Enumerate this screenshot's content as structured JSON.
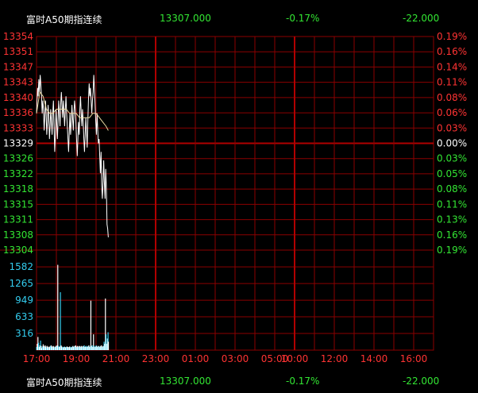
{
  "header": {
    "title": "富时A50期指连续",
    "price": "13307.000",
    "pct_change": "-0.17%",
    "change": "-22.000"
  },
  "footer": {
    "title": "富时A50期指连续",
    "price": "13307.000",
    "pct_change": "-0.17%",
    "change": "-22.000"
  },
  "colors": {
    "grid": "#8b0000",
    "grid_mid": "#b00000",
    "price_line": "#ffffff",
    "avg_line": "#e8d8a0",
    "up": "#ff3333",
    "down": "#33e633",
    "flat": "#ffffff",
    "volume_axis": "#33ccee",
    "volume_bar": "#ffffff",
    "volume_bar_alt": "#33ccee"
  },
  "chart_data": {
    "type": "line",
    "price_axis": {
      "ticks": [
        "13354",
        "13351",
        "13347",
        "13343",
        "13340",
        "13336",
        "13333",
        "13329",
        "13326",
        "13322",
        "13318",
        "13315",
        "13311",
        "13308",
        "13304"
      ],
      "base": 13329,
      "ylim": [
        13304,
        13354
      ]
    },
    "pct_axis": {
      "ticks": [
        "0.19%",
        "0.16%",
        "0.14%",
        "0.11%",
        "0.08%",
        "0.06%",
        "0.03%",
        "0.00%",
        "0.03%",
        "0.05%",
        "0.08%",
        "0.11%",
        "0.13%",
        "0.16%",
        "0.19%"
      ]
    },
    "volume_axis": {
      "ticks": [
        "1582",
        "1265",
        "949",
        "633",
        "316"
      ],
      "ylim": [
        0,
        1900
      ]
    },
    "x_ticks": [
      "17:00",
      "19:00",
      "21:00",
      "23:00",
      "01:00",
      "03:00",
      "05:00",
      "10:00",
      "12:00",
      "14:00",
      "16:00"
    ],
    "x_tick_minutes": [
      0,
      120,
      240,
      360,
      480,
      600,
      720,
      780,
      900,
      1020,
      1140
    ],
    "x_range_minutes": [
      0,
      1200
    ],
    "series": [
      {
        "values": [
          [
            0,
            13336
          ],
          [
            3,
            13342
          ],
          [
            5,
            13340
          ],
          [
            7,
            13344
          ],
          [
            9,
            13341
          ],
          [
            11,
            13345
          ],
          [
            13,
            13343
          ],
          [
            15,
            13340
          ],
          [
            17,
            13336
          ],
          [
            19,
            13339
          ],
          [
            21,
            13337
          ],
          [
            23,
            13332
          ],
          [
            25,
            13335
          ],
          [
            27,
            13339
          ],
          [
            29,
            13336
          ],
          [
            31,
            13331
          ],
          [
            33,
            13334
          ],
          [
            35,
            13338
          ],
          [
            37,
            13335
          ],
          [
            39,
            13330
          ],
          [
            41,
            13333
          ],
          [
            43,
            13337
          ],
          [
            45,
            13334
          ],
          [
            47,
            13331
          ],
          [
            49,
            13336
          ],
          [
            51,
            13339
          ],
          [
            53,
            13333
          ],
          [
            55,
            13327
          ],
          [
            57,
            13331
          ],
          [
            59,
            13337
          ],
          [
            61,
            13334
          ],
          [
            63,
            13330
          ],
          [
            65,
            13334
          ],
          [
            67,
            13339
          ],
          [
            69,
            13336
          ],
          [
            71,
            13333
          ],
          [
            73,
            13338
          ],
          [
            75,
            13341
          ],
          [
            77,
            13338
          ],
          [
            79,
            13335
          ],
          [
            81,
            13339
          ],
          [
            83,
            13336
          ],
          [
            85,
            13333
          ],
          [
            87,
            13337
          ],
          [
            89,
            13340
          ],
          [
            91,
            13336
          ],
          [
            93,
            13333
          ],
          [
            95,
            13330
          ],
          [
            97,
            13327
          ],
          [
            99,
            13332
          ],
          [
            101,
            13336
          ],
          [
            103,
            13331
          ],
          [
            105,
            13334
          ],
          [
            107,
            13338
          ],
          [
            109,
            13335
          ],
          [
            111,
            13332
          ],
          [
            113,
            13336
          ],
          [
            115,
            13339
          ],
          [
            117,
            13337
          ],
          [
            119,
            13334
          ],
          [
            121,
            13330
          ],
          [
            123,
            13326
          ],
          [
            125,
            13330
          ],
          [
            127,
            13334
          ],
          [
            129,
            13331
          ],
          [
            131,
            13337
          ],
          [
            133,
            13340
          ],
          [
            135,
            13336
          ],
          [
            137,
            13333
          ],
          [
            139,
            13337
          ],
          [
            141,
            13334
          ],
          [
            143,
            13330
          ],
          [
            145,
            13327
          ],
          [
            147,
            13331
          ],
          [
            149,
            13335
          ],
          [
            151,
            13332
          ],
          [
            153,
            13328
          ],
          [
            155,
            13334
          ],
          [
            157,
            13339
          ],
          [
            159,
            13343
          ],
          [
            161,
            13340
          ],
          [
            163,
            13342
          ],
          [
            165,
            13339
          ],
          [
            167,
            13336
          ],
          [
            169,
            13339
          ],
          [
            171,
            13341
          ],
          [
            173,
            13345
          ],
          [
            175,
            13342
          ],
          [
            177,
            13338
          ],
          [
            179,
            13334
          ],
          [
            181,
            13331
          ],
          [
            183,
            13336
          ],
          [
            185,
            13332
          ],
          [
            187,
            13329
          ],
          [
            189,
            13330
          ],
          [
            191,
            13326
          ],
          [
            193,
            13322
          ],
          [
            195,
            13327
          ],
          [
            197,
            13319
          ],
          [
            199,
            13316
          ],
          [
            201,
            13320
          ],
          [
            203,
            13325
          ],
          [
            205,
            13320
          ],
          [
            207,
            13316
          ],
          [
            209,
            13323
          ],
          [
            211,
            13319
          ],
          [
            213,
            13310
          ],
          [
            215,
            13309
          ],
          [
            217,
            13307
          ]
        ]
      },
      {
        "values": [
          [
            0,
            13336
          ],
          [
            10,
            13341
          ],
          [
            20,
            13340
          ],
          [
            30,
            13337
          ],
          [
            40,
            13336
          ],
          [
            50,
            13336
          ],
          [
            60,
            13337
          ],
          [
            70,
            13337
          ],
          [
            80,
            13337
          ],
          [
            90,
            13337
          ],
          [
            100,
            13336
          ],
          [
            110,
            13336
          ],
          [
            120,
            13336
          ],
          [
            130,
            13335
          ],
          [
            140,
            13335
          ],
          [
            150,
            13335
          ],
          [
            160,
            13335
          ],
          [
            170,
            13336
          ],
          [
            180,
            13336
          ],
          [
            190,
            13335
          ],
          [
            200,
            13334
          ],
          [
            210,
            13333
          ],
          [
            217,
            13332
          ]
        ]
      }
    ],
    "volume": [
      [
        0,
        60
      ],
      [
        2,
        120
      ],
      [
        4,
        250
      ],
      [
        6,
        140
      ],
      [
        8,
        60
      ],
      [
        10,
        90
      ],
      [
        12,
        180
      ],
      [
        14,
        80
      ],
      [
        16,
        40
      ],
      [
        18,
        70
      ],
      [
        20,
        110
      ],
      [
        22,
        80
      ],
      [
        24,
        60
      ],
      [
        26,
        90
      ],
      [
        28,
        70
      ],
      [
        30,
        50
      ],
      [
        32,
        80
      ],
      [
        34,
        60
      ],
      [
        36,
        50
      ],
      [
        38,
        70
      ],
      [
        40,
        60
      ],
      [
        42,
        80
      ],
      [
        44,
        90
      ],
      [
        46,
        70
      ],
      [
        48,
        60
      ],
      [
        50,
        80
      ],
      [
        52,
        70
      ],
      [
        54,
        50
      ],
      [
        56,
        60
      ],
      [
        58,
        80
      ],
      [
        60,
        70
      ],
      [
        62,
        90
      ],
      [
        64,
        1620
      ],
      [
        66,
        80
      ],
      [
        68,
        60
      ],
      [
        70,
        70
      ],
      [
        72,
        1100
      ],
      [
        74,
        90
      ],
      [
        76,
        70
      ],
      [
        78,
        60
      ],
      [
        80,
        50
      ],
      [
        82,
        60
      ],
      [
        84,
        70
      ],
      [
        86,
        60
      ],
      [
        88,
        50
      ],
      [
        90,
        60
      ],
      [
        92,
        70
      ],
      [
        94,
        60
      ],
      [
        96,
        50
      ],
      [
        98,
        60
      ],
      [
        100,
        70
      ],
      [
        102,
        60
      ],
      [
        104,
        50
      ],
      [
        106,
        60
      ],
      [
        108,
        70
      ],
      [
        110,
        80
      ],
      [
        112,
        60
      ],
      [
        114,
        70
      ],
      [
        116,
        80
      ],
      [
        118,
        90
      ],
      [
        120,
        60
      ],
      [
        122,
        70
      ],
      [
        124,
        80
      ],
      [
        126,
        60
      ],
      [
        128,
        70
      ],
      [
        130,
        80
      ],
      [
        132,
        60
      ],
      [
        134,
        70
      ],
      [
        136,
        80
      ],
      [
        138,
        60
      ],
      [
        140,
        70
      ],
      [
        142,
        80
      ],
      [
        144,
        90
      ],
      [
        146,
        60
      ],
      [
        148,
        70
      ],
      [
        150,
        80
      ],
      [
        152,
        60
      ],
      [
        154,
        70
      ],
      [
        156,
        80
      ],
      [
        158,
        90
      ],
      [
        160,
        60
      ],
      [
        162,
        70
      ],
      [
        164,
        940
      ],
      [
        166,
        80
      ],
      [
        168,
        90
      ],
      [
        170,
        60
      ],
      [
        172,
        300
      ],
      [
        174,
        80
      ],
      [
        176,
        60
      ],
      [
        178,
        70
      ],
      [
        180,
        90
      ],
      [
        182,
        80
      ],
      [
        184,
        60
      ],
      [
        186,
        70
      ],
      [
        188,
        80
      ],
      [
        190,
        60
      ],
      [
        192,
        70
      ],
      [
        194,
        80
      ],
      [
        196,
        90
      ],
      [
        198,
        60
      ],
      [
        200,
        70
      ],
      [
        202,
        80
      ],
      [
        204,
        160
      ],
      [
        206,
        120
      ],
      [
        208,
        980
      ],
      [
        210,
        300
      ],
      [
        212,
        120
      ],
      [
        214,
        220
      ],
      [
        216,
        340
      ],
      [
        217,
        160
      ]
    ]
  }
}
